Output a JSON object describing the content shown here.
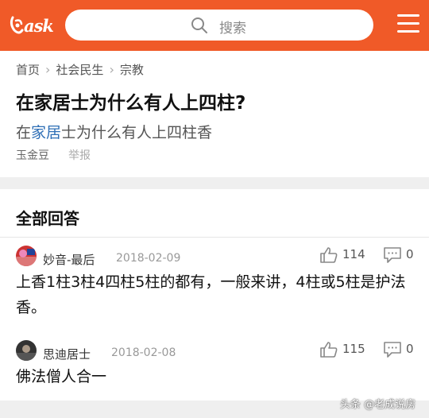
{
  "header": {
    "logo_text": "ask",
    "search_placeholder": "搜索"
  },
  "breadcrumb": [
    "首页",
    "社会民生",
    "宗教"
  ],
  "question": {
    "title": "在家居士为什么有人上四柱?",
    "subtitle_pre": "在",
    "subtitle_link": "家居",
    "subtitle_post": "士为什么有人上四柱香",
    "author": "玉金豆",
    "report_label": "举报"
  },
  "answers_section": {
    "heading": "全部回答",
    "answers": [
      {
        "user": "妙音-最后",
        "date": "2018-02-09",
        "likes": "114",
        "comments": "0",
        "body": "上香1柱3柱4四柱5柱的都有，一般来讲，4柱或5柱是护法香。"
      },
      {
        "user": "思迪居士",
        "date": "2018-02-08",
        "likes": "115",
        "comments": "0",
        "body": "佛法僧人合一"
      }
    ]
  },
  "watermark": "头条 @老成说房",
  "colors": {
    "brand": "#f05a28",
    "link": "#2f6fb6"
  }
}
